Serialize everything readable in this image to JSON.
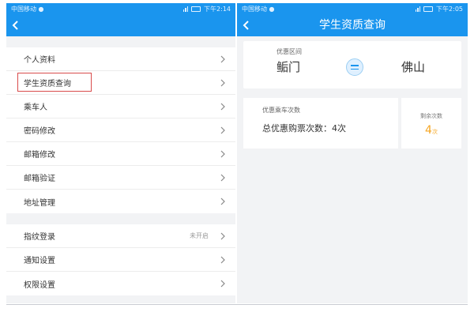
{
  "left": {
    "statusbar": {
      "carrier": "中国移动 ●",
      "time": "下午2:14"
    },
    "menu_group_1": [
      {
        "label": "个人资料"
      },
      {
        "label": "学生资质查询"
      },
      {
        "label": "乘车人"
      },
      {
        "label": "密码修改"
      },
      {
        "label": "邮箱修改"
      },
      {
        "label": "邮箱验证"
      },
      {
        "label": "地址管理"
      }
    ],
    "menu_group_2": [
      {
        "label": "指纹登录",
        "status": "未开启"
      },
      {
        "label": "通知设置"
      },
      {
        "label": "权限设置"
      }
    ]
  },
  "right": {
    "statusbar": {
      "carrier": "中国移动 ●",
      "time": "下午2:05"
    },
    "title": "学生资质查询",
    "route": {
      "label": "优惠区间",
      "from": "鲘门",
      "to": "佛山"
    },
    "usage": {
      "label": "优惠乘车次数",
      "total_text": "总优惠购票次数：4次"
    },
    "remaining": {
      "label": "剩余次数",
      "value": "4",
      "unit": "次"
    }
  },
  "colors": {
    "brand": "#1a95ee",
    "highlight": "#d94b4b",
    "accent": "#f5a623"
  },
  "icons": [
    "back-arrow-icon",
    "chevron-right-icon",
    "swap-icon",
    "signal-icon",
    "battery-icon"
  ]
}
